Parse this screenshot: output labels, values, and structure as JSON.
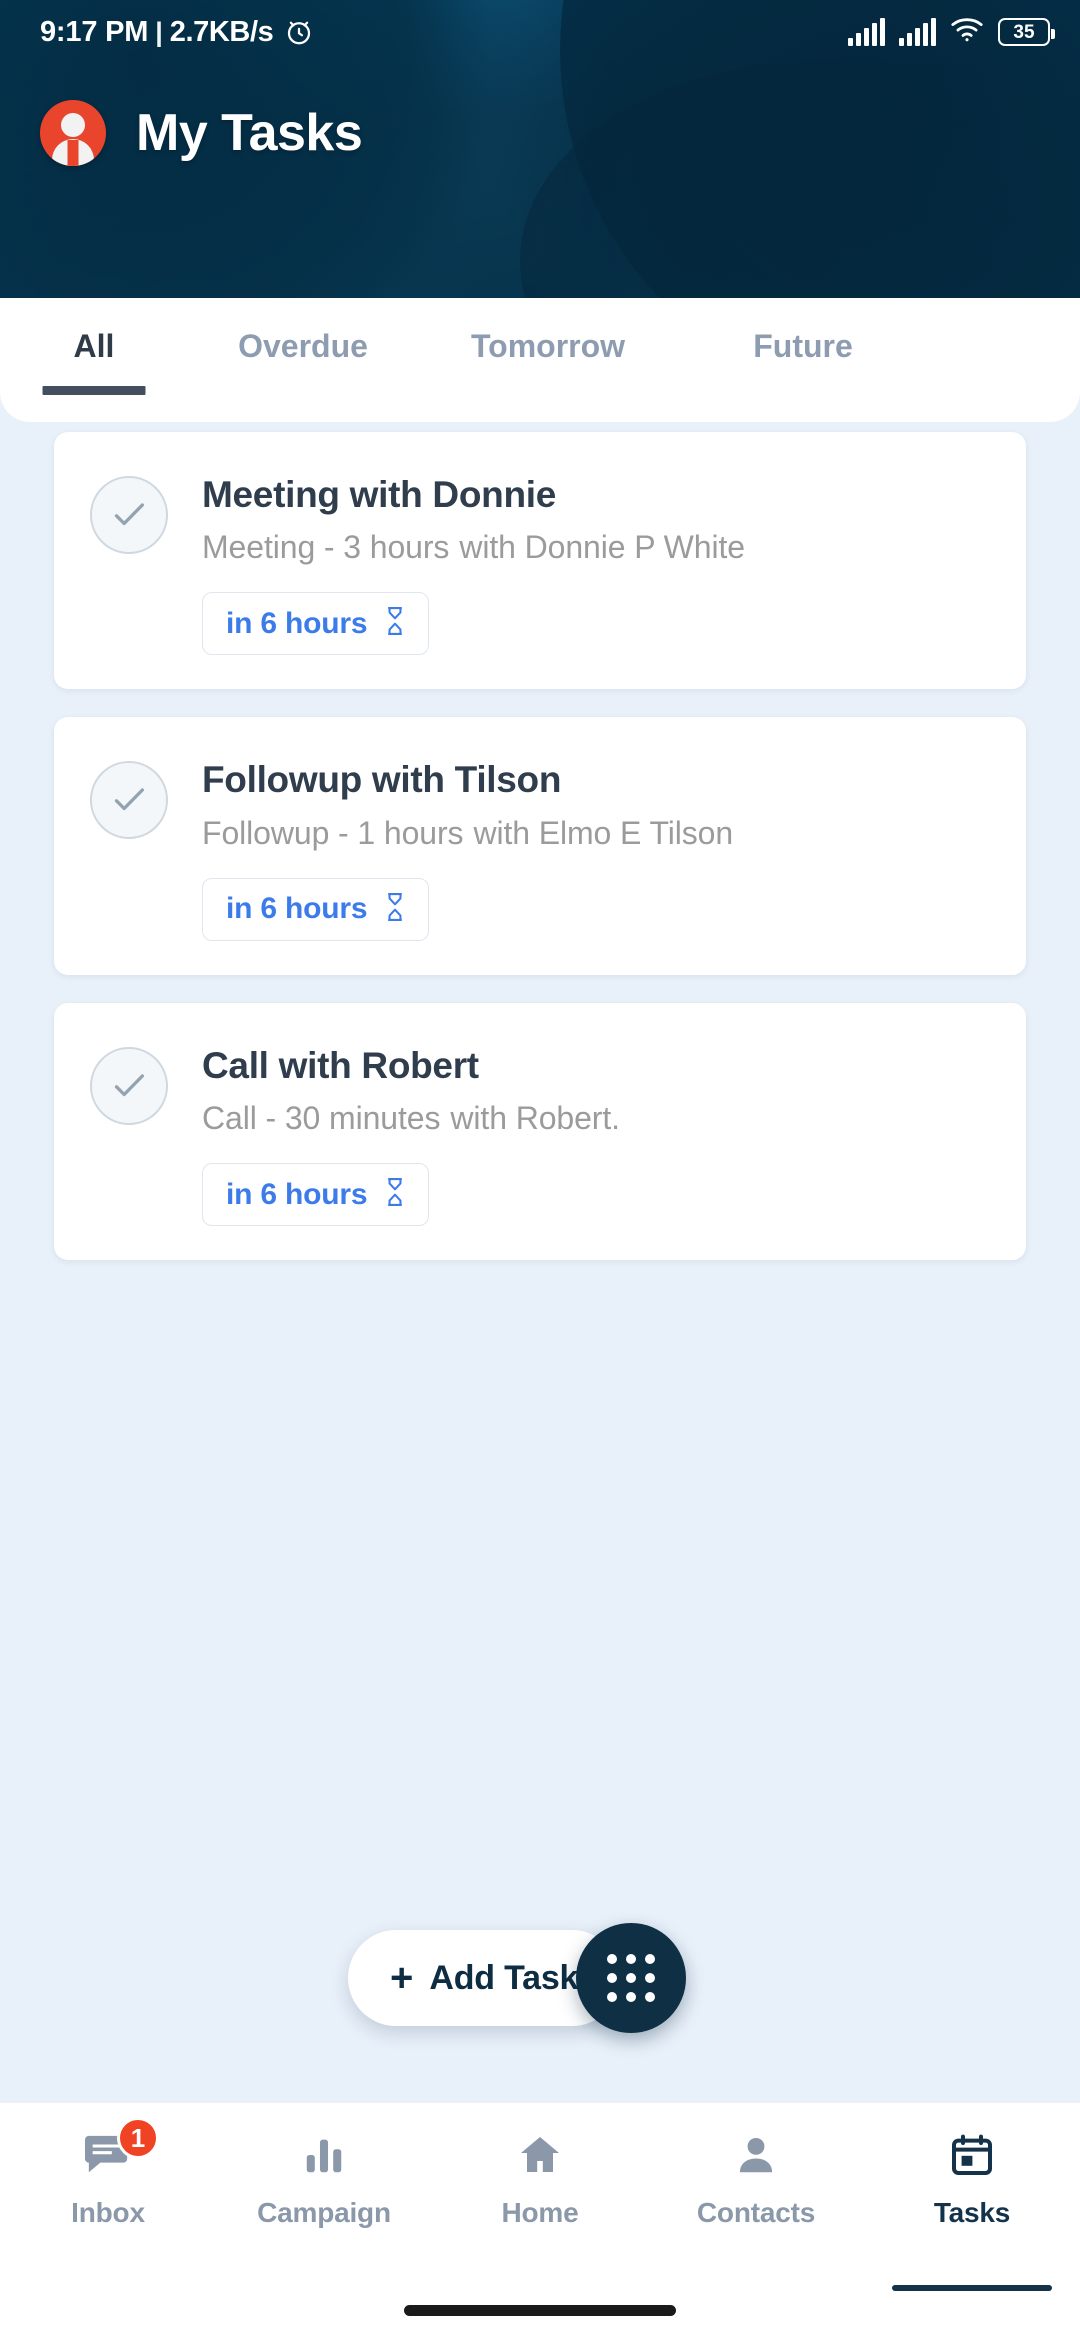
{
  "status_bar": {
    "time": "9:17 PM",
    "separator": "|",
    "network_speed": "2.7KB/s",
    "alarm_icon": "alarm-clock-icon",
    "signal_icon_1": "signal-bars-icon",
    "signal_icon_2": "signal-bars-icon",
    "wifi_icon": "wifi-icon",
    "battery_level": "35"
  },
  "header": {
    "title": "My Tasks",
    "avatar_icon": "user-avatar-icon",
    "avatar_color": "#e8452c",
    "gradient_from": "#1184c0",
    "gradient_to": "#063149"
  },
  "tabs": {
    "active_index": 0,
    "items": [
      {
        "label": "All"
      },
      {
        "label": "Overdue"
      },
      {
        "label": "Tomorrow"
      },
      {
        "label": "Future"
      }
    ],
    "active_color": "#2f3b49",
    "inactive_color": "#8d9cb0"
  },
  "tasks": [
    {
      "title": "Meeting with Donnie",
      "meta": "Meeting - 3 hours",
      "contact": "with Donnie P White",
      "due_label": "in 6 hours",
      "due_icon": "hourglass-icon",
      "checkbox_icon": "check-circle-icon"
    },
    {
      "title": "Followup with Tilson",
      "meta": "Followup - 1 hours",
      "contact": "with Elmo E Tilson",
      "due_label": "in 6 hours",
      "due_icon": "hourglass-icon",
      "checkbox_icon": "check-circle-icon"
    },
    {
      "title": "Call with Robert",
      "meta": "Call - 30 minutes",
      "contact": "with Robert.",
      "due_label": "in 6 hours",
      "due_icon": "hourglass-icon",
      "checkbox_icon": "check-circle-icon"
    }
  ],
  "actions": {
    "add_task_plus": "+",
    "add_task_label": "Add Task",
    "grid_menu_icon": "dots-grid-icon",
    "fab_color": "#0f2f45"
  },
  "bottom_nav": {
    "active_index": 4,
    "items": [
      {
        "label": "Inbox",
        "icon": "chat-bubble-icon",
        "badge": "1"
      },
      {
        "label": "Campaign",
        "icon": "bar-chart-icon",
        "badge": ""
      },
      {
        "label": "Home",
        "icon": "home-icon",
        "badge": ""
      },
      {
        "label": "Contacts",
        "icon": "person-icon",
        "badge": ""
      },
      {
        "label": "Tasks",
        "icon": "calendar-icon",
        "badge": ""
      }
    ],
    "badge_color": "#f04323",
    "active_color": "#14334a",
    "inactive_color": "#8a98a9"
  },
  "colors": {
    "page_background": "#e8f0f9",
    "card_background": "#ffffff",
    "title_text": "#2f3d4d",
    "subtitle_text": "#9b9b9b",
    "badge_text": "#3b7bea"
  }
}
